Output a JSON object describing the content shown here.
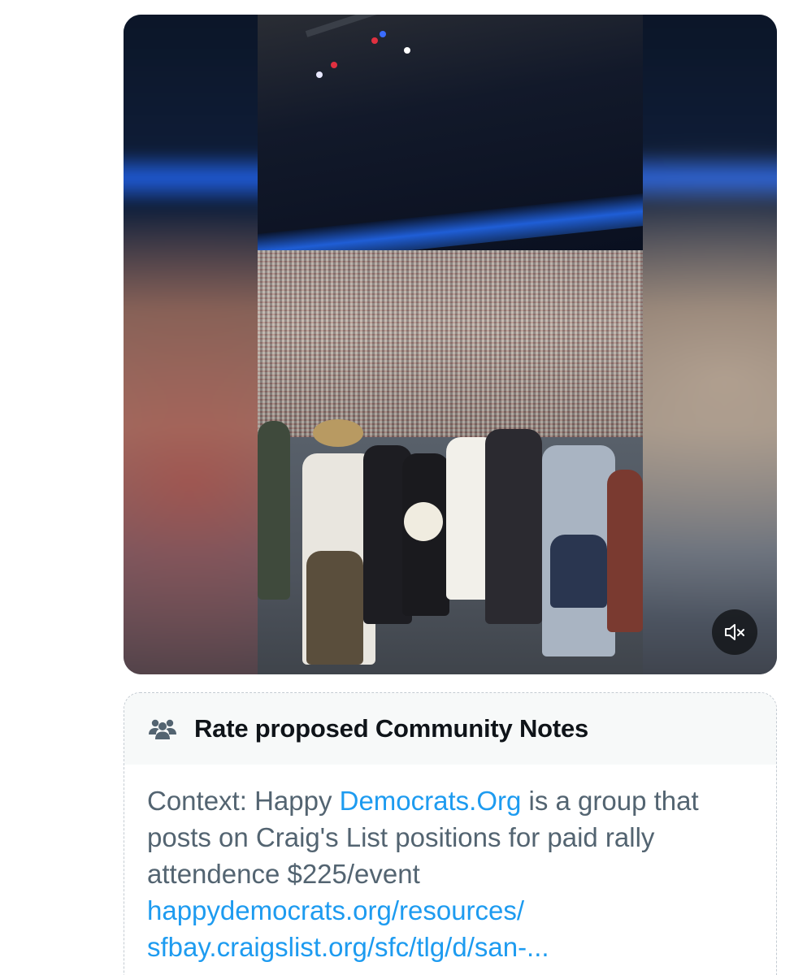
{
  "video": {
    "muted_icon": "speaker-muted-icon"
  },
  "community_notes": {
    "header_icon": "people-group-icon",
    "title": "Rate proposed Community Notes",
    "note": {
      "prefix": "Context:  Happy ",
      "inline_link": "Democrats.Org",
      "suffix": " is a group that posts on Craig's List positions for paid rally attendence $225/event",
      "links": [
        "happydemocrats.org/resources/",
        "sfbay.craigslist.org/sfc/tlg/d/san-..."
      ]
    }
  },
  "colors": {
    "link": "#1d9bf0",
    "body_text": "#536471",
    "title_text": "#0f1419",
    "header_bg": "#f7f9f9",
    "dashed_border": "#c4cbd2"
  }
}
